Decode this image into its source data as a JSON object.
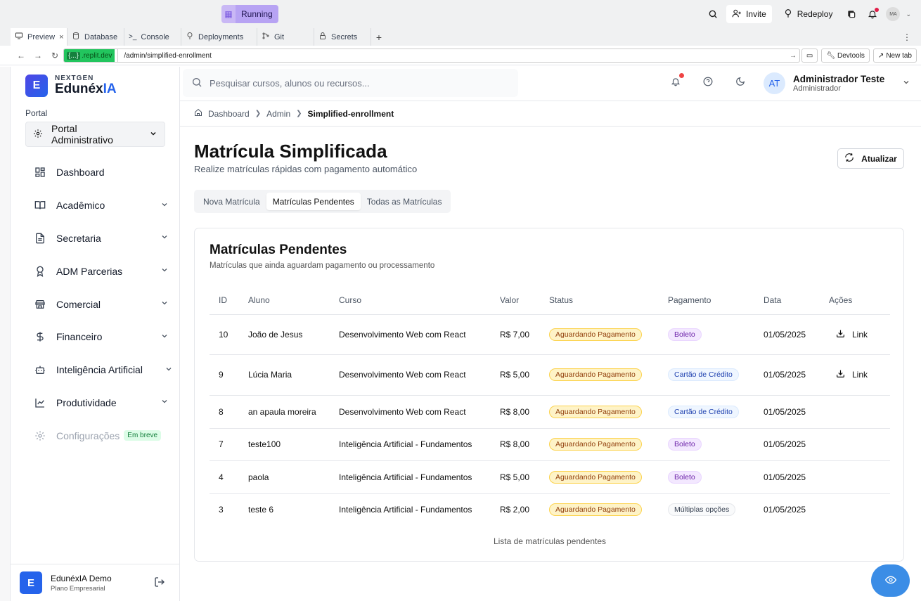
{
  "replit": {
    "run_status": "Running",
    "invite_label": "Invite",
    "redeploy_label": "Redeploy",
    "avatar_initials": "MA",
    "tabs": [
      {
        "label": "Preview",
        "icon": "monitor-icon"
      },
      {
        "label": "Database",
        "icon": "database-icon"
      },
      {
        "label": "Console",
        "icon": "terminal-icon"
      },
      {
        "label": "Deployments",
        "icon": "deploy-icon"
      },
      {
        "label": "Git",
        "icon": "git-icon"
      },
      {
        "label": "Secrets",
        "icon": "lock-icon"
      }
    ],
    "url_host": ".replit.dev",
    "url_host_brace": "{...}",
    "url_path": "/admin/simplified-enrollment",
    "devtools_label": "Devtools",
    "newtab_label": "New tab"
  },
  "brand": {
    "sub": "NEXTGEN",
    "name_main": "Edunéx",
    "name_accent": "IA",
    "logo_letter": "E"
  },
  "sidebar": {
    "portal_label": "Portal",
    "portal_value": "Portal Administrativo",
    "items": [
      {
        "label": "Dashboard",
        "icon": "dashboard-icon",
        "expandable": false
      },
      {
        "label": "Acadêmico",
        "icon": "book-icon",
        "expandable": true
      },
      {
        "label": "Secretaria",
        "icon": "file-icon",
        "expandable": true
      },
      {
        "label": "ADM Parcerias",
        "icon": "award-icon",
        "expandable": true
      },
      {
        "label": "Comercial",
        "icon": "store-icon",
        "expandable": true
      },
      {
        "label": "Financeiro",
        "icon": "dollar-icon",
        "expandable": true
      },
      {
        "label": "Inteligência Artificial",
        "icon": "bot-icon",
        "expandable": true
      },
      {
        "label": "Produtividade",
        "icon": "chart-line-icon",
        "expandable": true
      },
      {
        "label": "Configurações",
        "icon": "gear-icon",
        "expandable": false,
        "badge": "Em breve"
      }
    ],
    "footer": {
      "logo_letter": "E",
      "name": "EdunéxIA Demo",
      "plan": "Plano Empresarial"
    }
  },
  "header": {
    "search_placeholder": "Pesquisar cursos, alunos ou recursos...",
    "user_initials": "AT",
    "user_name": "Administrador Teste",
    "user_role": "Administrador"
  },
  "breadcrumb": [
    "Dashboard",
    "Admin",
    "Simplified-enrollment"
  ],
  "page": {
    "title": "Matrícula Simplificada",
    "subtitle": "Realize matrículas rápidas com pagamento automático",
    "refresh_label": "Atualizar",
    "tabs": [
      "Nova Matrícula",
      "Matrículas Pendentes",
      "Todas as Matrículas"
    ],
    "active_tab": "Matrículas Pendentes"
  },
  "card": {
    "title": "Matrículas Pendentes",
    "subtitle": "Matrículas que ainda aguardam pagamento ou processamento",
    "columns": [
      "ID",
      "Aluno",
      "Curso",
      "Valor",
      "Status",
      "Pagamento",
      "Data",
      "Ações"
    ],
    "rows": [
      {
        "id": "10",
        "aluno": "João de Jesus",
        "curso": "Desenvolvimento Web com React",
        "valor": "R$ 7,00",
        "status": "Aguardando Pagamento",
        "pagamento": "Boleto",
        "pay_kind": "boleto",
        "data": "01/05/2025",
        "acao": "Link"
      },
      {
        "id": "9",
        "aluno": "Lúcia Maria",
        "curso": "Desenvolvimento Web com React",
        "valor": "R$ 5,00",
        "status": "Aguardando Pagamento",
        "pagamento": "Cartão de Crédito",
        "pay_kind": "credit",
        "data": "01/05/2025",
        "acao": "Link"
      },
      {
        "id": "8",
        "aluno": "an apaula moreira",
        "curso": "Desenvolvimento Web com React",
        "valor": "R$ 8,00",
        "status": "Aguardando Pagamento",
        "pagamento": "Cartão de Crédito",
        "pay_kind": "credit",
        "data": "01/05/2025",
        "acao": ""
      },
      {
        "id": "7",
        "aluno": "teste100",
        "curso": "Inteligência Artificial - Fundamentos",
        "valor": "R$ 8,00",
        "status": "Aguardando Pagamento",
        "pagamento": "Boleto",
        "pay_kind": "boleto",
        "data": "01/05/2025",
        "acao": ""
      },
      {
        "id": "4",
        "aluno": "paola",
        "curso": "Inteligência Artificial - Fundamentos",
        "valor": "R$ 5,00",
        "status": "Aguardando Pagamento",
        "pagamento": "Boleto",
        "pay_kind": "boleto",
        "data": "01/05/2025",
        "acao": ""
      },
      {
        "id": "3",
        "aluno": "teste 6",
        "curso": "Inteligência Artificial - Fundamentos",
        "valor": "R$ 2,00",
        "status": "Aguardando Pagamento",
        "pagamento": "Múltiplas opções",
        "pay_kind": "multi",
        "data": "01/05/2025",
        "acao": ""
      }
    ],
    "caption": "Lista de matrículas pendentes"
  }
}
